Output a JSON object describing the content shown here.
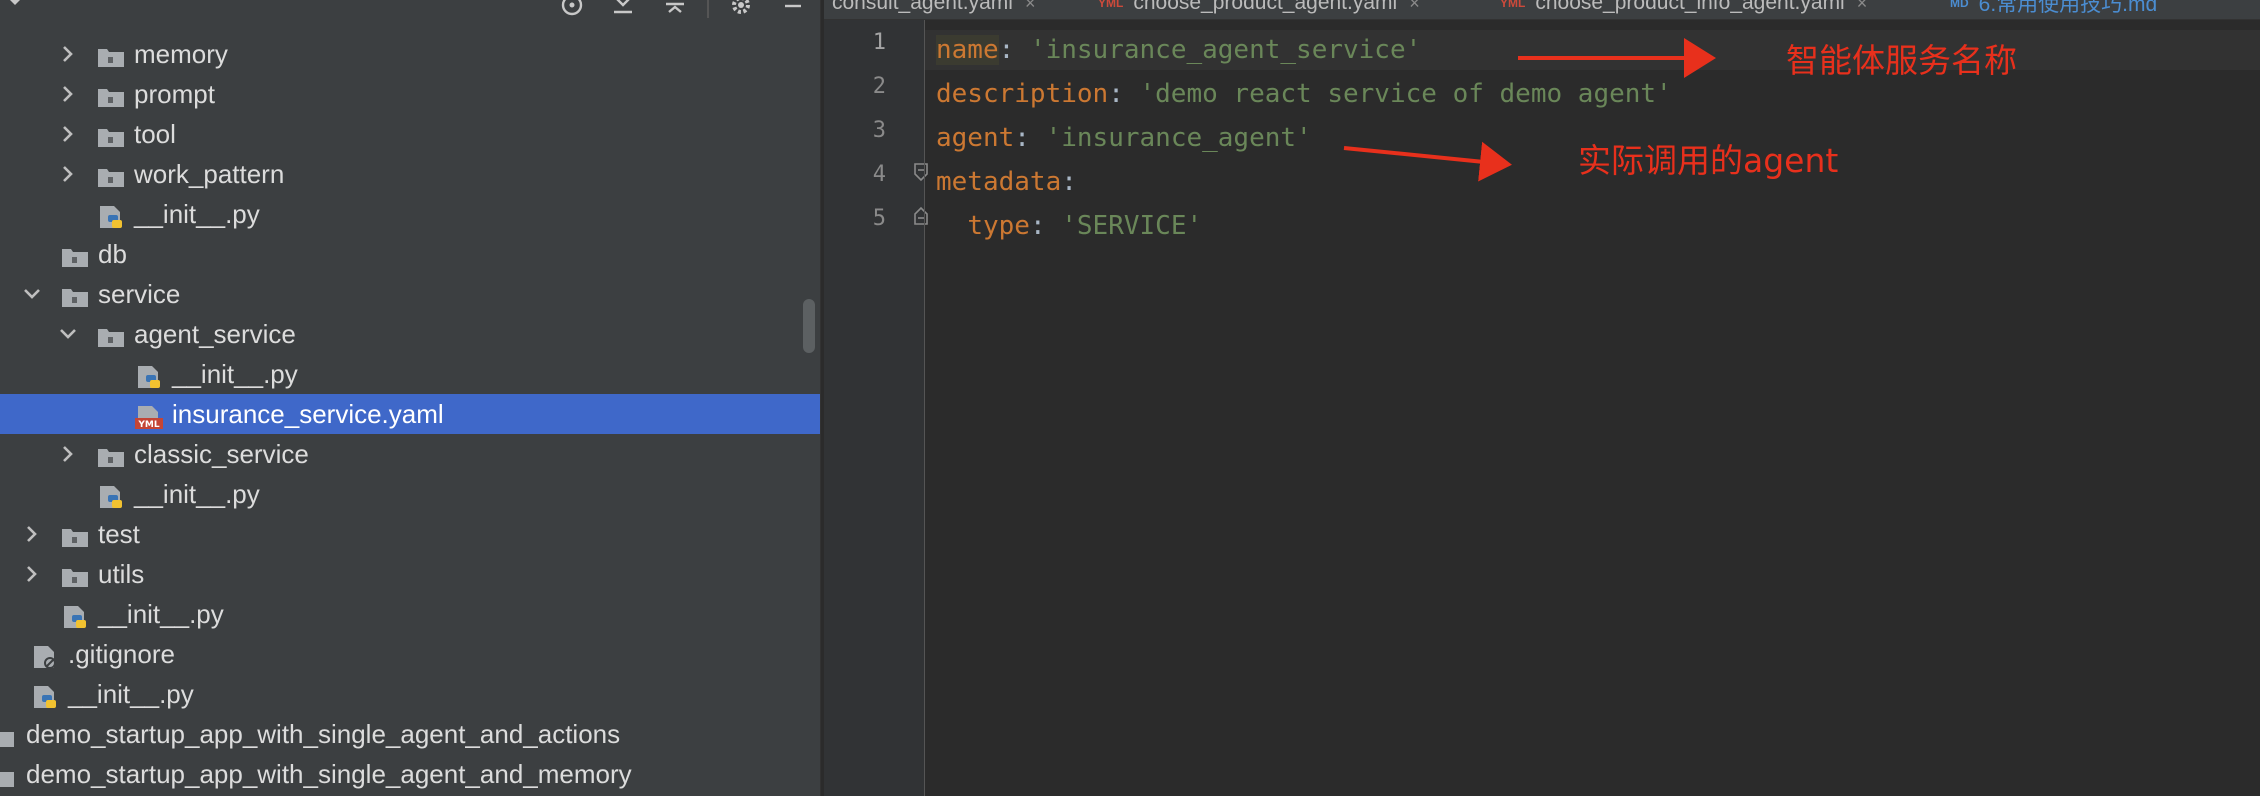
{
  "sidebar": {
    "tree": [
      {
        "label": "memory",
        "type": "folder",
        "level": 2,
        "expandable": true,
        "expanded": false
      },
      {
        "label": "prompt",
        "type": "folder",
        "level": 2,
        "expandable": true,
        "expanded": false
      },
      {
        "label": "tool",
        "type": "folder",
        "level": 2,
        "expandable": true,
        "expanded": false
      },
      {
        "label": "work_pattern",
        "type": "folder",
        "level": 2,
        "expandable": true,
        "expanded": false
      },
      {
        "label": "__init__.py",
        "type": "python",
        "level": 2,
        "expandable": false
      },
      {
        "label": "db",
        "type": "folder",
        "level": 1,
        "expandable": false
      },
      {
        "label": "service",
        "type": "folder",
        "level": 1,
        "expandable": true,
        "expanded": true
      },
      {
        "label": "agent_service",
        "type": "folder",
        "level": 2,
        "expandable": true,
        "expanded": true
      },
      {
        "label": "__init__.py",
        "type": "python",
        "level": 3,
        "expandable": false
      },
      {
        "label": "insurance_service.yaml",
        "type": "yaml",
        "level": 3,
        "expandable": false,
        "selected": true
      },
      {
        "label": "classic_service",
        "type": "folder",
        "level": 2,
        "expandable": true,
        "expanded": false
      },
      {
        "label": "__init__.py",
        "type": "python",
        "level": 2,
        "expandable": false
      },
      {
        "label": "test",
        "type": "folder",
        "level": 1,
        "expandable": true,
        "expanded": false
      },
      {
        "label": "utils",
        "type": "folder",
        "level": 1,
        "expandable": true,
        "expanded": false
      },
      {
        "label": "__init__.py",
        "type": "python",
        "level": 1,
        "expandable": false
      },
      {
        "label": ".gitignore",
        "type": "gitignore",
        "level": 0,
        "expandable": false
      },
      {
        "label": "__init__.py",
        "type": "python",
        "level": 0,
        "expandable": false
      },
      {
        "label": "demo_startup_app_with_single_agent_and_actions",
        "type": "module",
        "level": -1,
        "expandable": false
      },
      {
        "label": "demo_startup_app_with_single_agent_and_memory",
        "type": "module",
        "level": -1,
        "expandable": false
      }
    ]
  },
  "editor": {
    "tabs": [
      {
        "label": "consult_agent.yaml",
        "badge": "",
        "kind": "yaml"
      },
      {
        "label": "choose_product_agent.yaml",
        "badge": "YML",
        "kind": "yaml"
      },
      {
        "label": "choose_product_info_agent.yaml",
        "badge": "YML",
        "kind": "yaml"
      },
      {
        "label": "6.常用使用技巧.md",
        "badge": "MD",
        "kind": "md"
      }
    ],
    "line_numbers": [
      "1",
      "2",
      "3",
      "4",
      "5"
    ],
    "lines": [
      {
        "indent": "",
        "key": "name",
        "sep": ": ",
        "value": "'insurance_agent_service'"
      },
      {
        "indent": "",
        "key": "description",
        "sep": ": ",
        "value": "'demo react service of demo agent'"
      },
      {
        "indent": "",
        "key": "agent",
        "sep": ": ",
        "value": "'insurance_agent'"
      },
      {
        "indent": "",
        "key": "metadata",
        "sep": ":",
        "value": ""
      },
      {
        "indent": "  ",
        "key": "type",
        "sep": ": ",
        "value": "'SERVICE'"
      }
    ]
  },
  "annotations": {
    "service_name": "智能体服务名称",
    "actual_agent": "实际调用的agent"
  },
  "colors": {
    "sidebar_bg": "#3c3f41",
    "selection": "#3f68c9",
    "editor_bg": "#2b2b2b",
    "key": "#cc7832",
    "string": "#6a8759",
    "annotation": "#e8301c"
  }
}
